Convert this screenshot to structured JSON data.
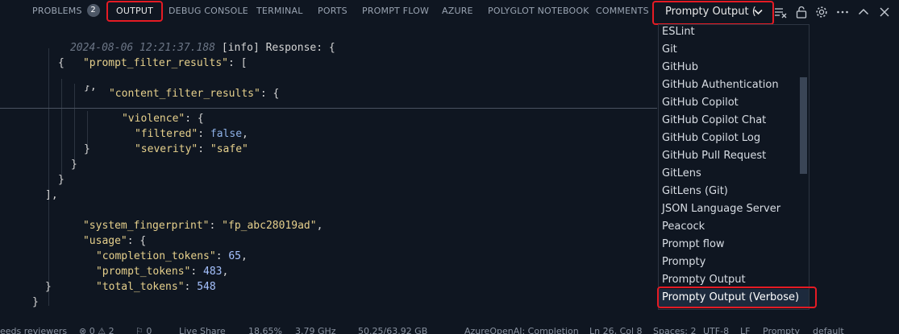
{
  "tabs": [
    {
      "label": "PROBLEMS",
      "badge": "2"
    },
    {
      "label": "OUTPUT"
    },
    {
      "label": "DEBUG CONSOLE"
    },
    {
      "label": "TERMINAL"
    },
    {
      "label": "PORTS"
    },
    {
      "label": "PROMPT FLOW"
    },
    {
      "label": "AZURE"
    },
    {
      "label": "POLYGLOT NOTEBOOK"
    },
    {
      "label": "COMMENTS"
    }
  ],
  "output_selector": {
    "value": "Prompty Output ("
  },
  "toolbar_icons": [
    "clear-output-icon",
    "lock-icon",
    "gear-icon",
    "more-icon",
    "chevron-up-icon",
    "close-icon"
  ],
  "log": {
    "timestamp": "2024-08-06 12:21:37.188",
    "level": "[info]",
    "message": " Response: {",
    "keys": {
      "prompt_filter_results": "\"prompt_filter_results\"",
      "content_filter_results": "\"content_filter_results\"",
      "violence": "\"violence\"",
      "filtered": "\"filtered\"",
      "severity": "\"severity\"",
      "system_fingerprint": "\"system_fingerprint\"",
      "usage": "\"usage\"",
      "completion_tokens": "\"completion_tokens\"",
      "prompt_tokens": "\"prompt_tokens\"",
      "total_tokens": "\"total_tokens\""
    },
    "values": {
      "filtered": "false",
      "severity": "\"safe\"",
      "system_fingerprint": "\"fp_abc28019ad\"",
      "completion_tokens": "65",
      "prompt_tokens": "483",
      "total_tokens": "548"
    }
  },
  "dropdown": {
    "items": [
      "ESLint",
      "Git",
      "GitHub",
      "GitHub Authentication",
      "GitHub Copilot",
      "GitHub Copilot Chat",
      "GitHub Copilot Log",
      "GitHub Pull Request",
      "GitLens",
      "GitLens (Git)",
      "JSON Language Server",
      "Peacock",
      "Prompt flow",
      "Prompty",
      "Prompty Output",
      "Prompty Output (Verbose)"
    ],
    "selected": "Prompty Output (Verbose)"
  },
  "status_bar": {
    "items": [
      "eeds reviewers",
      "⊗ 0 ⚠ 2",
      "⚐ 0",
      "Live Share",
      "18.65%",
      "3.79 GHz",
      "50.25/63.92 GB",
      "AzureOpenAI: Completion",
      "Ln 26, Col 8",
      "Spaces: 2",
      "UTF-8",
      "LF",
      "Prompty",
      "default"
    ]
  },
  "colors": {
    "background": "#0f1621",
    "highlight": "#e51b24",
    "json_key": "#e6d08c",
    "json_number": "#a6c2ff",
    "json_keyword": "#8fb2e8"
  }
}
